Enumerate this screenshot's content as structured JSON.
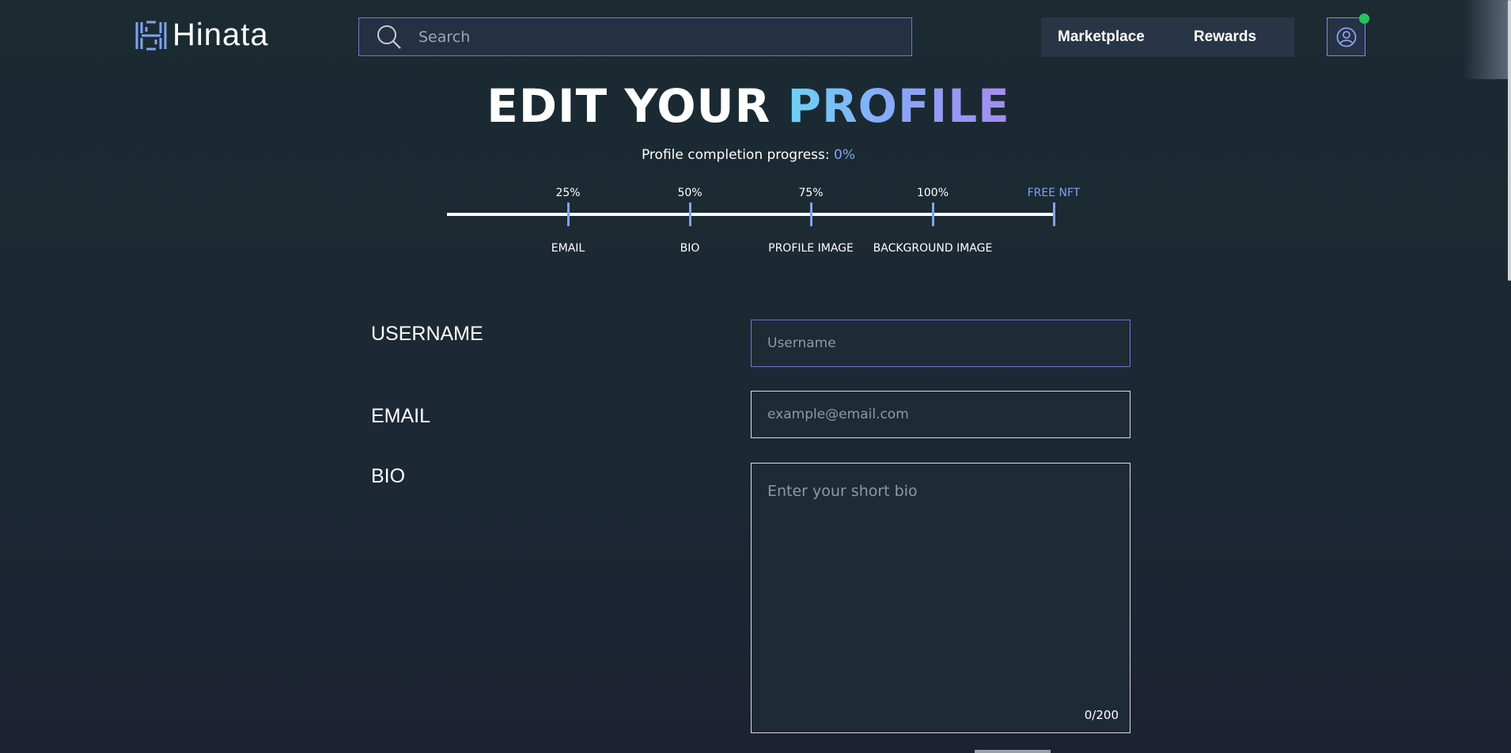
{
  "header": {
    "brand": "Hinata",
    "search_placeholder": "Search",
    "nav": {
      "marketplace": "Marketplace",
      "rewards": "Rewards"
    },
    "icons": {
      "logo": "hinata-logo",
      "search": "search-icon",
      "profile": "user-circle-icon",
      "status": "online-status-dot"
    },
    "status_color": "#22c55e"
  },
  "page": {
    "title_main": "EDIT YOUR ",
    "title_accent": "PROFILE",
    "progress_label": "Profile completion progress: ",
    "progress_value": "0%"
  },
  "milestones": {
    "completion_fraction": 0,
    "top": [
      "25%",
      "50%",
      "75%",
      "100%",
      "FREE NFT"
    ],
    "bottom": [
      "EMAIL",
      "BIO",
      "PROFILE IMAGE",
      "BACKGROUND IMAGE"
    ]
  },
  "form": {
    "username": {
      "label": "USERNAME",
      "placeholder": "Username",
      "value": ""
    },
    "email": {
      "label": "EMAIL",
      "placeholder": "example@email.com",
      "value": ""
    },
    "bio": {
      "label": "BIO",
      "placeholder": "Enter your short bio",
      "value": "",
      "counter": "0/200"
    }
  },
  "colors": {
    "accent": "#7fa3ef",
    "input_focus_border": "#6b79d6",
    "background": "#1b2b31"
  }
}
